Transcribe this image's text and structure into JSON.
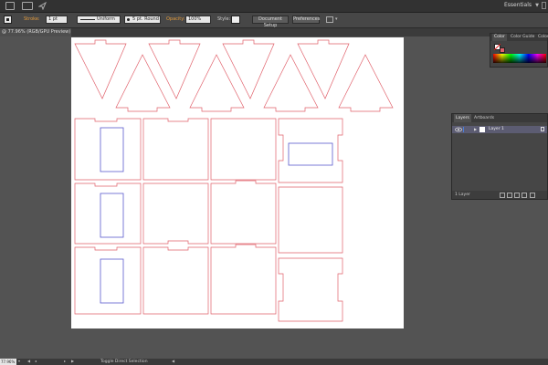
{
  "app": {
    "workspace": "Essentials"
  },
  "control_bar": {
    "stroke_label": "Stroke:",
    "stroke_weight": "1 pt",
    "stroke_profile": "Uniform",
    "brush": "5 pt. Round",
    "opacity_label": "Opacity:",
    "opacity_value": "100%",
    "style_label": "Style:",
    "document_setup": "Document Setup",
    "preferences": "Preferences"
  },
  "document": {
    "tab_label": "@ 77.96% (RGB/GPU Preview)"
  },
  "color_panel": {
    "tabs": [
      "Color",
      "Color Guide",
      "Color"
    ]
  },
  "layers_panel": {
    "tabs": [
      "Layers",
      "Artboards"
    ],
    "layers": [
      {
        "name": "Layer 1"
      }
    ],
    "footer_count": "1 Layer"
  },
  "status_bar": {
    "zoom": "77.96%",
    "tool": "Toggle Direct Selection"
  },
  "colors": {
    "cut_line": "#e0606a",
    "window_line": "#5a5acd",
    "layer_color": "#4b7fd8"
  }
}
